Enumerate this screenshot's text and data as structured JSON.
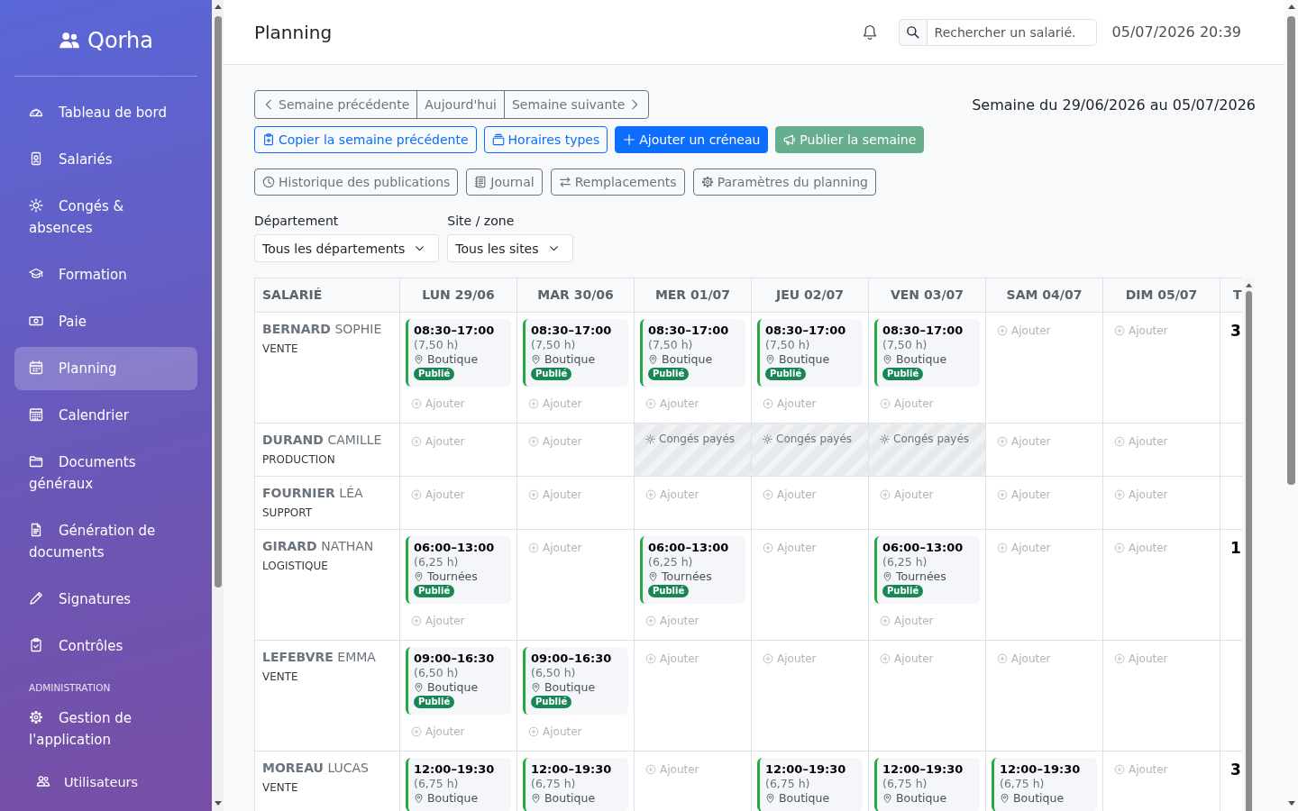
{
  "sidebar": {
    "brand": "Qorha",
    "items": [
      {
        "label": "Tableau de bord",
        "selected": false
      },
      {
        "label": "Salariés",
        "selected": false
      },
      {
        "label": "Congés & absences",
        "selected": false
      },
      {
        "label": "Formation",
        "selected": false
      },
      {
        "label": "Paie",
        "selected": false
      },
      {
        "label": "Planning",
        "selected": true
      },
      {
        "label": "Calendrier",
        "selected": false
      },
      {
        "label": "Documents généraux",
        "selected": false
      },
      {
        "label": "Génération de documents",
        "selected": false
      },
      {
        "label": "Signatures",
        "selected": false
      },
      {
        "label": "Contrôles",
        "selected": false
      }
    ],
    "sections": [
      {
        "title": "ADMINISTRATION",
        "items": [
          {
            "label": "Gestion de l'application",
            "selected": false,
            "children": [
              {
                "label": "Utilisateurs",
                "selected": false
              }
            ]
          }
        ]
      }
    ]
  },
  "header": {
    "title": "Planning",
    "search": {
      "placeholder": "Rechercher un salarié."
    },
    "datetime": "05/07/2026 20:39"
  },
  "toolbar": {
    "week_nav": [
      {
        "label": "Semaine précédente",
        "kind": "prev"
      },
      {
        "label": "Aujourd'hui",
        "kind": "today"
      },
      {
        "label": "Semaine suivante",
        "kind": "next"
      }
    ],
    "week_label": "Semaine du 29/06/2026 au 05/07/2026",
    "actions": [
      {
        "label": "Copier la semaine précédente",
        "kind": "outline",
        "disabled": false
      },
      {
        "label": "Horaires types",
        "kind": "outline",
        "disabled": false
      },
      {
        "label": "Ajouter un créneau",
        "kind": "primary",
        "disabled": false
      },
      {
        "label": "Publier la semaine",
        "kind": "success",
        "disabled": true
      }
    ],
    "tools": [
      "Historique des publications",
      "Journal",
      "Remplacements",
      "Paramètres du planning"
    ]
  },
  "filters": [
    {
      "label": "Département",
      "value": "Tous les départements"
    },
    {
      "label": "Site / zone",
      "value": "Tous les sites"
    }
  ],
  "table": {
    "columns": [
      "SALARIÉ",
      "LUN 29/06",
      "MAR 30/06",
      "MER 01/07",
      "JEU 02/07",
      "VEN 03/07",
      "SAM 04/07",
      "DIM 05/07",
      "T"
    ],
    "rows": [
      {
        "employee": "**BERNARD** SOPHIE",
        "department": "VENTE",
        "days": [
          {
            "kind": "shift",
            "time": "08:30–17:00",
            "hours": "(7,50 h)",
            "location": "Boutique",
            "badge": "Publié",
            "add": "Ajouter"
          },
          {
            "kind": "shift",
            "time": "08:30–17:00",
            "hours": "(7,50 h)",
            "location": "Boutique",
            "badge": "Publié",
            "add": "Ajouter"
          },
          {
            "kind": "shift",
            "time": "08:30–17:00",
            "hours": "(7,50 h)",
            "location": "Boutique",
            "badge": "Publié",
            "add": "Ajouter"
          },
          {
            "kind": "shift",
            "time": "08:30–17:00",
            "hours": "(7,50 h)",
            "location": "Boutique",
            "badge": "Publié",
            "add": "Ajouter"
          },
          {
            "kind": "shift",
            "time": "08:30–17:00",
            "hours": "(7,50 h)",
            "location": "Boutique",
            "badge": "Publié",
            "add": "Ajouter"
          },
          {
            "kind": "add",
            "add": "Ajouter"
          },
          {
            "kind": "add",
            "add": "Ajouter"
          }
        ],
        "total": "3"
      },
      {
        "employee": "**DURAND** CAMILLE",
        "department": "PRODUCTION",
        "days": [
          {
            "kind": "add",
            "add": "Ajouter"
          },
          {
            "kind": "add",
            "add": "Ajouter"
          },
          {
            "kind": "leave",
            "label": "Congés payés"
          },
          {
            "kind": "leave",
            "label": "Congés payés"
          },
          {
            "kind": "leave",
            "label": "Congés payés"
          },
          {
            "kind": "add",
            "add": "Ajouter"
          },
          {
            "kind": "add",
            "add": "Ajouter"
          }
        ]
      },
      {
        "employee": "**FOURNIER** LÉA",
        "department": "SUPPORT",
        "days": [
          {
            "kind": "add",
            "add": "Ajouter"
          },
          {
            "kind": "add",
            "add": "Ajouter"
          },
          {
            "kind": "add",
            "add": "Ajouter"
          },
          {
            "kind": "add",
            "add": "Ajouter"
          },
          {
            "kind": "add",
            "add": "Ajouter"
          },
          {
            "kind": "add",
            "add": "Ajouter"
          },
          {
            "kind": "add",
            "add": "Ajouter"
          }
        ]
      },
      {
        "employee": "**GIRARD** NATHAN",
        "department": "LOGISTIQUE",
        "days": [
          {
            "kind": "shift",
            "time": "06:00–13:00",
            "hours": "(6,25 h)",
            "location": "Tournées",
            "badge": "Publié",
            "add": "Ajouter"
          },
          {
            "kind": "add",
            "add": "Ajouter"
          },
          {
            "kind": "shift",
            "time": "06:00–13:00",
            "hours": "(6,25 h)",
            "location": "Tournées",
            "badge": "Publié",
            "add": "Ajouter"
          },
          {
            "kind": "add",
            "add": "Ajouter"
          },
          {
            "kind": "shift",
            "time": "06:00–13:00",
            "hours": "(6,25 h)",
            "location": "Tournées",
            "badge": "Publié",
            "add": "Ajouter"
          },
          {
            "kind": "add",
            "add": "Ajouter"
          },
          {
            "kind": "add",
            "add": "Ajouter"
          }
        ],
        "total": "1"
      },
      {
        "employee": "**LEFEBVRE** EMMA",
        "department": "VENTE",
        "days": [
          {
            "kind": "shift",
            "time": "09:00–16:30",
            "hours": "(6,50 h)",
            "location": "Boutique",
            "badge": "Publié",
            "add": "Ajouter"
          },
          {
            "kind": "shift",
            "time": "09:00–16:30",
            "hours": "(6,50 h)",
            "location": "Boutique",
            "badge": "Publié",
            "add": "Ajouter"
          },
          {
            "kind": "add",
            "add": "Ajouter"
          },
          {
            "kind": "add",
            "add": "Ajouter"
          },
          {
            "kind": "add",
            "add": "Ajouter"
          },
          {
            "kind": "add",
            "add": "Ajouter"
          },
          {
            "kind": "add",
            "add": "Ajouter"
          }
        ]
      },
      {
        "employee": "**MOREAU** LUCAS",
        "department": "VENTE",
        "days": [
          {
            "kind": "shift",
            "time": "12:00–19:30",
            "hours": "(6,75 h)",
            "location": "Boutique"
          },
          {
            "kind": "shift",
            "time": "12:00–19:30",
            "hours": "(6,75 h)",
            "location": "Boutique"
          },
          {
            "kind": "add",
            "add": "Ajouter"
          },
          {
            "kind": "shift",
            "time": "12:00–19:30",
            "hours": "(6,75 h)",
            "location": "Boutique"
          },
          {
            "kind": "shift",
            "time": "12:00–19:30",
            "hours": "(6,75 h)",
            "location": "Boutique"
          },
          {
            "kind": "shift",
            "time": "12:00–19:30",
            "hours": "(6,75 h)",
            "location": "Boutique"
          },
          {
            "kind": "add",
            "add": "Ajouter"
          }
        ],
        "total": "3"
      }
    ]
  }
}
